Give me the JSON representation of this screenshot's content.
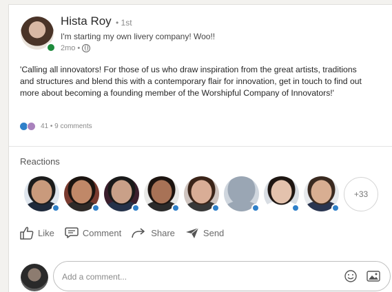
{
  "post": {
    "author_name": "Hista Roy",
    "degree": "• 1st",
    "headline": "I'm starting my own livery company! Woo!!",
    "time": "2mo",
    "time_separator": "•",
    "text": "'Calling all innovators! For those of us who draw inspiration from the great artists, traditions and structures and blend this with a contemporary flair for innovation, get in touch to find out more about becoming a founding member of the Worshipful Company of Innovators!'",
    "social_counts": "41 • 9 comments"
  },
  "reactions": {
    "title": "Reactions",
    "people": [
      {
        "bg": "#dfe6ee",
        "face": "#c99a7c",
        "hair": "#1c1c1c",
        "shirt": "#1f2a3b"
      },
      {
        "bg": "#7a3b30",
        "face": "#c08868",
        "hair": "#1b1410",
        "shirt": "#2e2a28"
      },
      {
        "bg": "#3b1f2d",
        "face": "#c9a088",
        "hair": "#1a1a1a",
        "shirt": "#25324a"
      },
      {
        "bg": "#e8e8e6",
        "face": "#a87256",
        "hair": "#1d1410",
        "shirt": "#2b2b2b"
      },
      {
        "bg": "#cfc4bf",
        "face": "#d9ad96",
        "hair": "#3b2418",
        "shirt": "#383838"
      },
      {
        "bg": "#cfd6de",
        "face": "#9aa6b4",
        "hair": "#9aa6b4",
        "shirt": "#9aa6b4"
      },
      {
        "bg": "#d8dde3",
        "face": "#e3c2ad",
        "hair": "#1e1612",
        "shirt": "#ffffff"
      },
      {
        "bg": "#e6e9ec",
        "face": "#d8ae92",
        "hair": "#3a2a20",
        "shirt": "#2a3550"
      }
    ],
    "more_label": "+33"
  },
  "actions": {
    "like": "Like",
    "comment": "Comment",
    "share": "Share",
    "send": "Send"
  },
  "comment_box": {
    "placeholder": "Add a comment..."
  },
  "colors": {
    "like_blue": "#2f80c9",
    "online_green": "#1e8b3c",
    "celebrate_purple": "#a982bd"
  },
  "icons": {
    "like": "thumbs-up-icon",
    "comment": "speech-bubble-icon",
    "share": "share-arrow-icon",
    "send": "paper-plane-icon",
    "emoji": "smiley-icon",
    "image": "image-icon",
    "visibility": "globe-icon"
  }
}
